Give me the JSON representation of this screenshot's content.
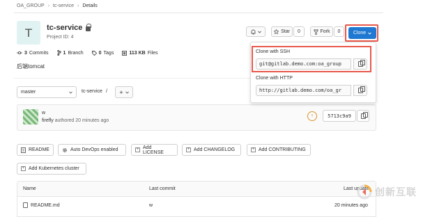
{
  "breadcrumb": {
    "group": "OA_GROUP",
    "project": "tc-service",
    "current": "Details",
    "sep": "›"
  },
  "project": {
    "avatar_letter": "T",
    "name": "tc-service",
    "id_text": "Project ID: 4",
    "description": "后端tomcat"
  },
  "actions": {
    "notify_icon": "bell-icon",
    "star_label": "Star",
    "star_count": "0",
    "fork_label": "Fork",
    "fork_count": "0",
    "clone_label": "Clone"
  },
  "stats": {
    "commits": "3",
    "commits_label": "Commits",
    "branches": "1",
    "branches_label": "Branch",
    "tags": "0",
    "tags_label": "Tags",
    "size": "113 KB",
    "size_label": "Files"
  },
  "repo_nav": {
    "branch": "master",
    "path": "tc-service",
    "path_sep": "/",
    "add_label": "+"
  },
  "commit": {
    "title": "w",
    "author": "firefly",
    "meta": "authored 20 minutes ago",
    "sha": "5713c9a9",
    "pipeline_status": "!!"
  },
  "clone_dropdown": {
    "ssh_label": "Clone with SSH",
    "ssh_url": "git@gitlab.demo.com:oa_group",
    "http_label": "Clone with HTTP",
    "http_url": "http://gitlab.demo.com/oa_gr"
  },
  "quick_actions": {
    "readme": "README",
    "auto_devops": "Auto DevOps enabled",
    "add_license": "Add LICENSE",
    "add_changelog": "Add CHANGELOG",
    "add_contributing": "Add CONTRIBUTING",
    "add_k8s": "Add Kubernetes cluster"
  },
  "file_table": {
    "col_name": "Name",
    "col_commit": "Last commit",
    "col_update": "Last update",
    "rows": [
      {
        "name": "README.md",
        "commit": "w",
        "updated": "20 minutes ago"
      }
    ]
  },
  "watermark": {
    "text": "创新互联"
  },
  "colors": {
    "primary": "#1f78d1",
    "highlight": "#e8574a",
    "pipeline": "#d99530"
  }
}
